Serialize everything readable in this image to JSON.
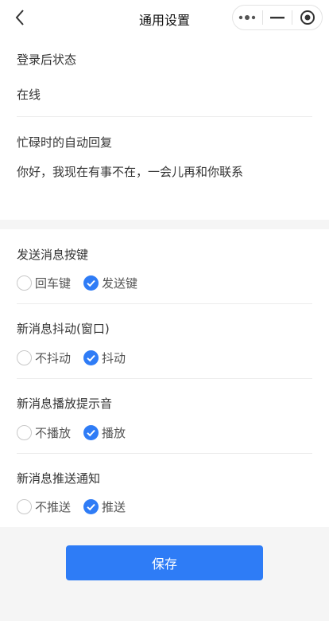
{
  "nav": {
    "title": "通用设置",
    "icons": {
      "back": "chevron-left-icon",
      "more": "more-dots-icon",
      "minimize": "minimize-icon",
      "close": "target-circle-icon"
    }
  },
  "status": {
    "label": "登录后状态",
    "value": "在线"
  },
  "auto_reply": {
    "label": "忙碌时的自动回复",
    "value": "你好，我现在有事不在，一会儿再和你联系"
  },
  "send_key": {
    "label": "发送消息按键",
    "options": [
      {
        "label": "回车键",
        "checked": false
      },
      {
        "label": "发送键",
        "checked": true
      }
    ]
  },
  "shake": {
    "label": "新消息抖动(窗口)",
    "options": [
      {
        "label": "不抖动",
        "checked": false
      },
      {
        "label": "抖动",
        "checked": true
      }
    ]
  },
  "sound": {
    "label": "新消息播放提示音",
    "options": [
      {
        "label": "不播放",
        "checked": false
      },
      {
        "label": "播放",
        "checked": true
      }
    ]
  },
  "push": {
    "label": "新消息推送通知",
    "options": [
      {
        "label": "不推送",
        "checked": false
      },
      {
        "label": "推送",
        "checked": true
      }
    ]
  },
  "save_label": "保存",
  "colors": {
    "accent": "#2e7cf6",
    "background": "#f5f5f5"
  }
}
